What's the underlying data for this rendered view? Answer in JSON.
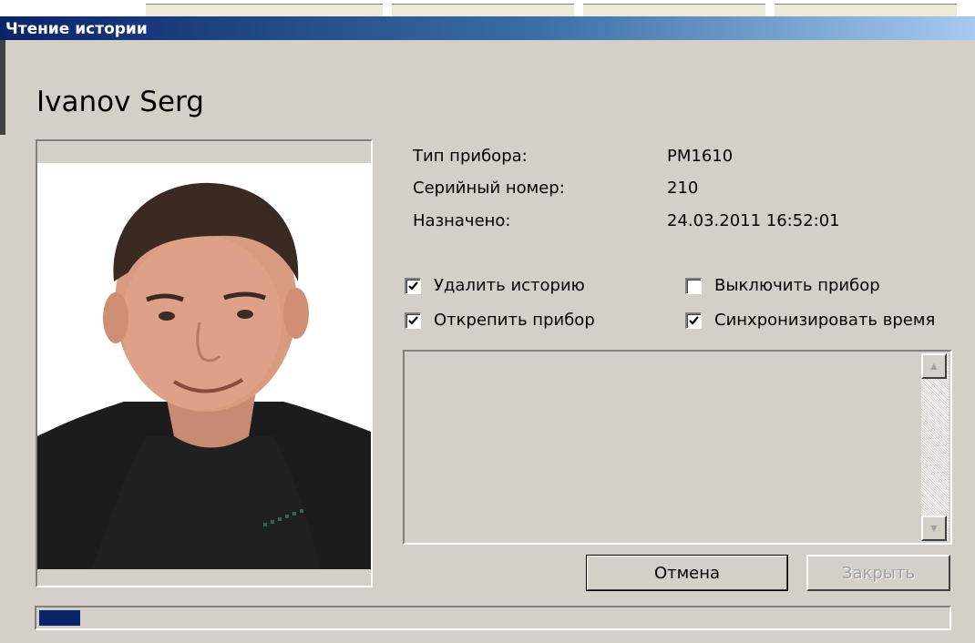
{
  "window": {
    "title": "Чтение истории"
  },
  "user": {
    "name": "Ivanov Serg"
  },
  "device_info": [
    {
      "label": "Тип прибора:",
      "value": "PM1610"
    },
    {
      "label": "Серийный номер:",
      "value": "210"
    },
    {
      "label": "Назначено:",
      "value": "24.03.2011 16:52:01"
    }
  ],
  "options": {
    "delete_history": {
      "label": "Удалить историю",
      "checked": true
    },
    "detach_device": {
      "label": "Открепить прибор",
      "checked": true
    },
    "turn_off_device": {
      "label": "Выключить прибор",
      "checked": false
    },
    "sync_time": {
      "label": "Синхронизировать время",
      "checked": true
    }
  },
  "log": {
    "text": ""
  },
  "buttons": {
    "cancel_label": "Отмена",
    "close_label": "Закрыть"
  },
  "progress": {
    "fraction": 0.045
  },
  "colors": {
    "title_gradient_start": "#0a246a",
    "title_gradient_end": "#a6caf0",
    "progress_fill": "#0a246a",
    "face": "#d4d0c8"
  }
}
